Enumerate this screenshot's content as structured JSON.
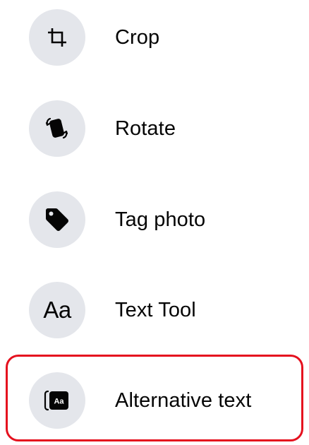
{
  "menu": {
    "items": [
      {
        "label": "Crop",
        "icon": "crop-icon"
      },
      {
        "label": "Rotate",
        "icon": "rotate-icon"
      },
      {
        "label": "Tag photo",
        "icon": "tag-icon"
      },
      {
        "label": "Text Tool",
        "icon": "text-tool-icon",
        "icon_text": "Aa"
      },
      {
        "label": "Alternative text",
        "icon": "alt-text-icon",
        "icon_text": "Aa",
        "highlighted": true
      }
    ]
  },
  "colors": {
    "icon_bg": "#e4e6eb",
    "text": "#050505",
    "highlight_border": "#e5101e"
  }
}
